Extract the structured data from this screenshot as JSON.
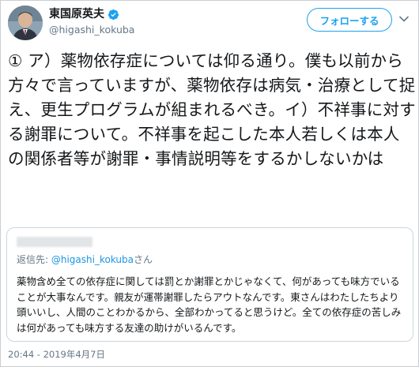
{
  "author": {
    "display_name": "東国原英夫",
    "handle": "@higashi_kokuba"
  },
  "follow_button_label": "フォローする",
  "tweet": {
    "text": "① ア）薬物依存症については仰る通り。僕も以前から方々で言っていますが、薬物依存は病気・治療として捉え、更生プログラムが組まれるべき。イ）不祥事に対する謝罪について。不祥事を起こした本人若しくは本人の関係者等が謝罪・事情説明等をするかしないかは"
  },
  "quoted_tweet": {
    "reply_prefix": "返信先: ",
    "reply_mention": "@higashi_kokuba",
    "reply_suffix": "さん",
    "text": "薬物含め全ての依存症に関しては罰とか謝罪とかじゃなくて、何があっても味方でいることが大事なんです。親友が運帯謝罪したらアウトなんです。東さんはわたしたちより頭いいし、人間のことわかるから、全部わかってると思うけど。全ての依存症の苦しみは何があっても味方する友達の助けがいるんです。"
  },
  "timestamp": "20:44 - 2019年4月7日",
  "icons": {
    "verified": "verified-badge-icon",
    "caret": "chevron-down-icon"
  },
  "colors": {
    "accent": "#1da1f2",
    "secondary_text": "#657786",
    "border": "#ccd6dd"
  }
}
